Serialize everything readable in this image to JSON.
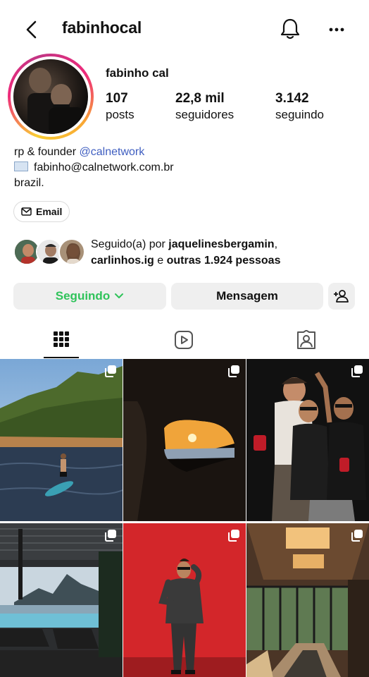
{
  "header": {
    "username": "fabinhocal",
    "back_icon": "chevron-left-icon",
    "bell_icon": "bell-icon",
    "more_icon": "more-horizontal-icon"
  },
  "profile": {
    "display_name": "fabinho cal",
    "stats": [
      {
        "value": "107",
        "label": "posts"
      },
      {
        "value": "22,8 mil",
        "label": "seguidores"
      },
      {
        "value": "3.142",
        "label": "seguindo"
      }
    ],
    "bio": {
      "line1_text": "rp & founder ",
      "line1_mention": "@calnetwork",
      "line2": "fabinho@calnetwork.com.br",
      "line3": "brazil."
    },
    "email_button": "Email"
  },
  "followed_by": {
    "prefix": "Seguido(a) por ",
    "user1": "jaquelinesbergamin",
    "comma": ",",
    "user2": "carlinhos.ig",
    "middle": " e ",
    "rest": "outras 1.924 pessoas"
  },
  "actions": {
    "following": "Seguindo",
    "message": "Mensagem"
  },
  "colors": {
    "accent_green": "#2fc35a",
    "mention_blue": "#3f5ec0",
    "button_bg": "#efefef"
  }
}
